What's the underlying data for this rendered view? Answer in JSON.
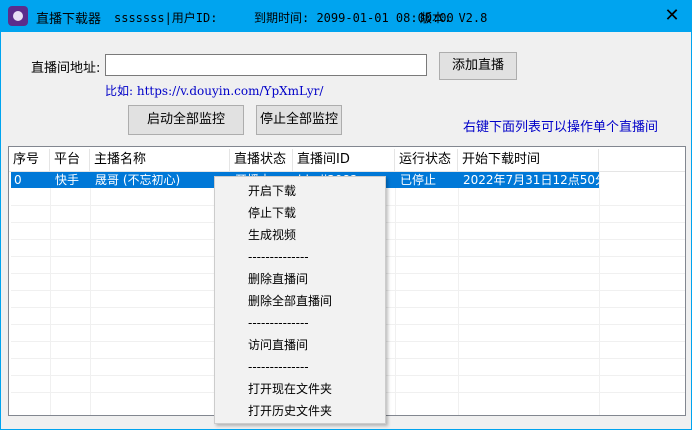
{
  "titlebar": {
    "title": "直播下载器",
    "user_info": "sssssss|用户ID:",
    "expire_info": "到期时间: 2099-01-01 08:00:00",
    "version": "版本: V2.8",
    "close_glyph": "✕"
  },
  "form": {
    "url_label": "直播间地址:",
    "url_value": "",
    "add_button": "添加直播",
    "example": "比如: https://v.douyin.com/YpXmLyr/",
    "start_all_button": "启动全部监控",
    "stop_all_button": "停止全部监控",
    "hint": "右键下面列表可以操作单个直播间"
  },
  "table": {
    "columns": [
      "序号",
      "平台",
      "主播名称",
      "直播状态",
      "直播间ID",
      "运行状态",
      "开始下载时间"
    ],
    "rows": [
      [
        "0",
        "快手",
        "晟哥 (不忘初心)",
        "开播中",
        "bhaji3082",
        "已停止",
        "2022年7月31日12点50分"
      ]
    ]
  },
  "context_menu": {
    "items": [
      "开启下载",
      "停止下载",
      "生成视频",
      "--------------",
      "删除直播间",
      "删除全部直播间",
      "--------------",
      "访问直播间",
      "--------------",
      "打开现在文件夹",
      "打开历史文件夹"
    ]
  }
}
